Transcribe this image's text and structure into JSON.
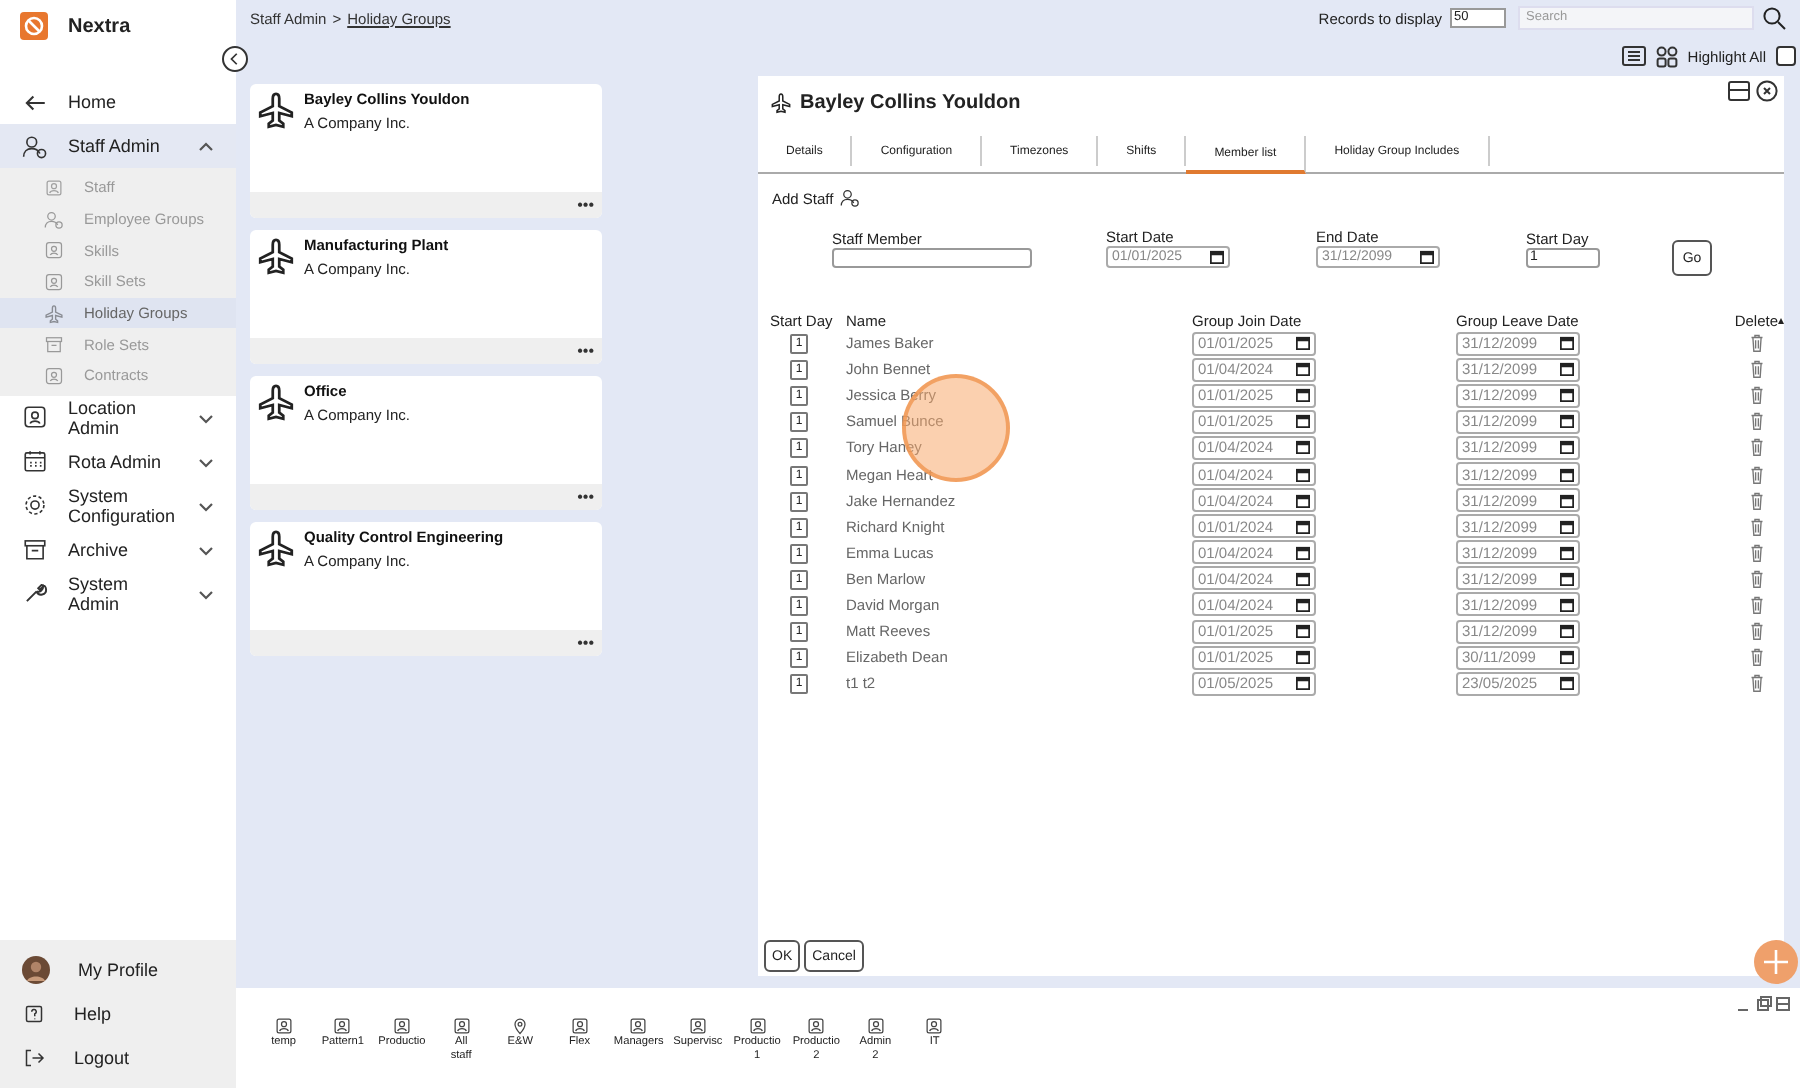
{
  "app": {
    "name": "Nextra"
  },
  "sidebar": {
    "items": [
      {
        "label": "Home",
        "kind": "back"
      },
      {
        "label": "Staff Admin",
        "kind": "group",
        "expanded": true,
        "children": [
          {
            "label": "Staff",
            "selected": false
          },
          {
            "label": "Employee Groups",
            "selected": false
          },
          {
            "label": "Skills",
            "selected": false
          },
          {
            "label": "Skill Sets",
            "selected": false
          },
          {
            "label": "Holiday Groups",
            "selected": true
          },
          {
            "label": "Role Sets",
            "selected": false
          },
          {
            "label": "Contracts",
            "selected": false
          }
        ]
      },
      {
        "label": "Location Admin",
        "kind": "group",
        "expanded": false
      },
      {
        "label": "Rota Admin",
        "kind": "group",
        "expanded": false
      },
      {
        "label": "System Configuration",
        "kind": "group",
        "expanded": false
      },
      {
        "label": "Archive",
        "kind": "group",
        "expanded": false
      },
      {
        "label": "System Admin",
        "kind": "group",
        "expanded": false
      }
    ],
    "bottom": [
      "My Profile",
      "Help",
      "Logout"
    ]
  },
  "breadcrumb": {
    "items": [
      "Staff Admin",
      "Holiday Groups"
    ],
    "separator": ">"
  },
  "toolbar": {
    "records_label": "Records to display",
    "records_value": "50",
    "search_placeholder": "Search",
    "highlight_label": "Highlight All",
    "highlight_checked": false
  },
  "cards": [
    {
      "title": "Bayley Collins Youldon",
      "subtitle": "A Company Inc.",
      "menu": "•••"
    },
    {
      "title": "Manufacturing Plant",
      "subtitle": "A Company Inc.",
      "menu": "•••"
    },
    {
      "title": "Office",
      "subtitle": "A Company Inc.",
      "menu": "•••"
    },
    {
      "title": "Quality Control Engineering",
      "subtitle": "A Company Inc.",
      "menu": "•••"
    }
  ],
  "panel": {
    "title": "Bayley Collins Youldon",
    "tabs": [
      {
        "label": "Details",
        "selected": false
      },
      {
        "label": "Configuration",
        "selected": false
      },
      {
        "label": "Timezones",
        "selected": false
      },
      {
        "label": "Shifts",
        "selected": false
      },
      {
        "label": "Member list",
        "selected": true
      },
      {
        "label": "Holiday Group Includes",
        "selected": false
      }
    ],
    "add_staff": "Add Staff",
    "form": {
      "staff_member": {
        "label": "Staff Member"
      },
      "start_date": {
        "label": "Start Date",
        "value": "01/01/2025"
      },
      "end_date": {
        "label": "End Date",
        "value": "31/12/2099"
      },
      "start_day": {
        "label": "Start Day",
        "value": "1"
      },
      "go": "Go"
    },
    "columns": [
      "Start Day",
      "Name",
      "Group Join Date",
      "Group Leave Date",
      "Delete"
    ],
    "sort_mark": "▴",
    "rows": [
      {
        "start_day": "1",
        "name": "James Baker",
        "join": "01/01/2025",
        "leave": "31/12/2099"
      },
      {
        "start_day": "1",
        "name": "John Bennet",
        "join": "01/04/2024",
        "leave": "31/12/2099"
      },
      {
        "start_day": "1",
        "name": "Jessica Berry",
        "join": "01/01/2025",
        "leave": "31/12/2099"
      },
      {
        "start_day": "1",
        "name": "Samuel Bunce",
        "join": "01/01/2025",
        "leave": "31/12/2099"
      },
      {
        "start_day": "1",
        "name": "Tory Haney",
        "join": "01/04/2024",
        "leave": "31/12/2099"
      },
      {
        "start_day": "1",
        "name": "Megan Heart",
        "join": "01/04/2024",
        "leave": "31/12/2099"
      },
      {
        "start_day": "1",
        "name": "Jake Hernandez",
        "join": "01/04/2024",
        "leave": "31/12/2099"
      },
      {
        "start_day": "1",
        "name": "Richard Knight",
        "join": "01/01/2024",
        "leave": "31/12/2099"
      },
      {
        "start_day": "1",
        "name": "Emma Lucas",
        "join": "01/04/2024",
        "leave": "31/12/2099"
      },
      {
        "start_day": "1",
        "name": "Ben Marlow",
        "join": "01/04/2024",
        "leave": "31/12/2099"
      },
      {
        "start_day": "1",
        "name": "David Morgan",
        "join": "01/04/2024",
        "leave": "31/12/2099"
      },
      {
        "start_day": "1",
        "name": "Matt Reeves",
        "join": "01/01/2025",
        "leave": "31/12/2099"
      },
      {
        "start_day": "1",
        "name": "Elizabeth Dean",
        "join": "01/01/2025",
        "leave": "30/11/2099"
      },
      {
        "start_day": "1",
        "name": "t1 t2",
        "join": "01/05/2025",
        "leave": "23/05/2025"
      }
    ],
    "buttons": [
      "OK",
      "Cancel"
    ]
  },
  "taskbar": [
    {
      "label": "temp",
      "kind": "person"
    },
    {
      "label": "Pattern1",
      "kind": "person"
    },
    {
      "label": "Productio",
      "kind": "person"
    },
    {
      "label": "All staff",
      "kind": "person"
    },
    {
      "label": "E&W",
      "kind": "pin"
    },
    {
      "label": "Flex",
      "kind": "person"
    },
    {
      "label": "Managers",
      "kind": "person"
    },
    {
      "label": "Supervisc",
      "kind": "person"
    },
    {
      "label": "Productio 1",
      "kind": "person"
    },
    {
      "label": "Productio 2",
      "kind": "person"
    },
    {
      "label": "Admin 2",
      "kind": "person"
    },
    {
      "label": "IT",
      "kind": "person"
    }
  ]
}
